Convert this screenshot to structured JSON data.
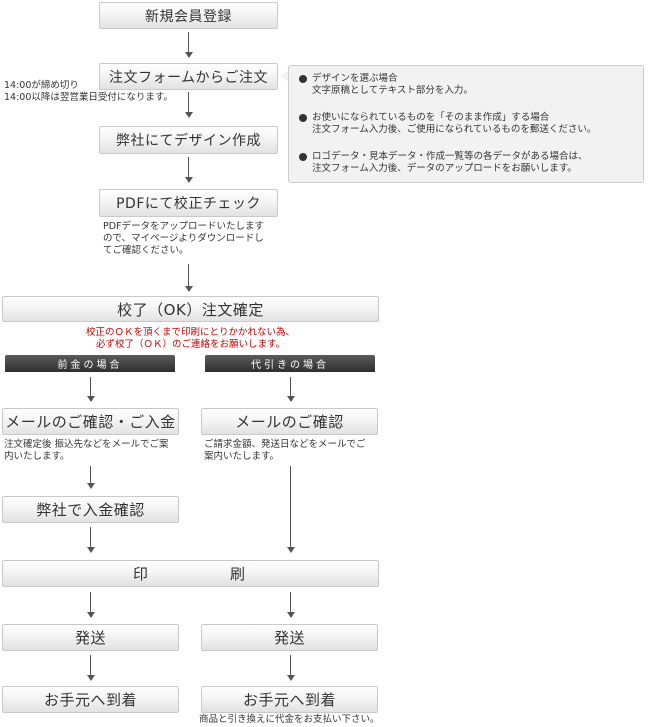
{
  "steps": {
    "register": "新規会員登録",
    "order_form": "注文フォームからご注文",
    "design": "弊社にてデザイン作成",
    "pdf_check": "PDFにて校正チェック",
    "approval": "校了（OK）注文確定",
    "mail_payment": "メールのご確認・ご入金",
    "mail_confirm": "メールのご確認",
    "payment_confirm": "弊社で入金確認",
    "print_1": "印",
    "print_2": "刷",
    "ship_left": "発送",
    "ship_right": "発送",
    "arrive_left": "お手元へ到着",
    "arrive_right": "お手元へ到着"
  },
  "deadline": {
    "line1": "14:00が締め切り",
    "line2": "14:00以降は翌営業日受付になります。"
  },
  "notes": [
    {
      "line1": "デザインを選ぶ場合",
      "line2": "文字原稿としてテキスト部分を入力。"
    },
    {
      "line1": "お使いになられているものを「そのまま作成」する場合",
      "line2": "注文フォーム入力後、ご使用になられているものを郵送ください。"
    },
    {
      "line1": "ロゴデータ・見本データ・作成一覧等の各データがある場合は、",
      "line2": "注文フォーム入力後、データのアップロードをお願いします。"
    }
  ],
  "pdf_note": {
    "line1": "PDFデータをアップロードいたします",
    "line2": "ので、マイページよりダウンロードし",
    "line3": "てご確認ください。"
  },
  "approval_note": {
    "line1": "校正のＯＫを頂くまで印刷にとりかかれない為、",
    "line2": "必ず校了（ＯＫ）のご連絡をお願いします。"
  },
  "branches": {
    "prepay": "前金の場合",
    "cod": "代引きの場合"
  },
  "prepay_note": {
    "line1": "注文確定後 振込先などをメールでご案",
    "line2": "内いたします。"
  },
  "cod_note": {
    "line1": "ご請求金額、発送日などをメールでご",
    "line2": "案内いたします。"
  },
  "cod_payment_note": "商品と引き換えに代金をお支払い下さい。",
  "colors": {
    "box_border": "#c9c9c9",
    "arrow": "#555555",
    "warning_text": "#cc0000",
    "branch_header": "#3a3a3a",
    "note_bg": "#f2f2f2"
  }
}
